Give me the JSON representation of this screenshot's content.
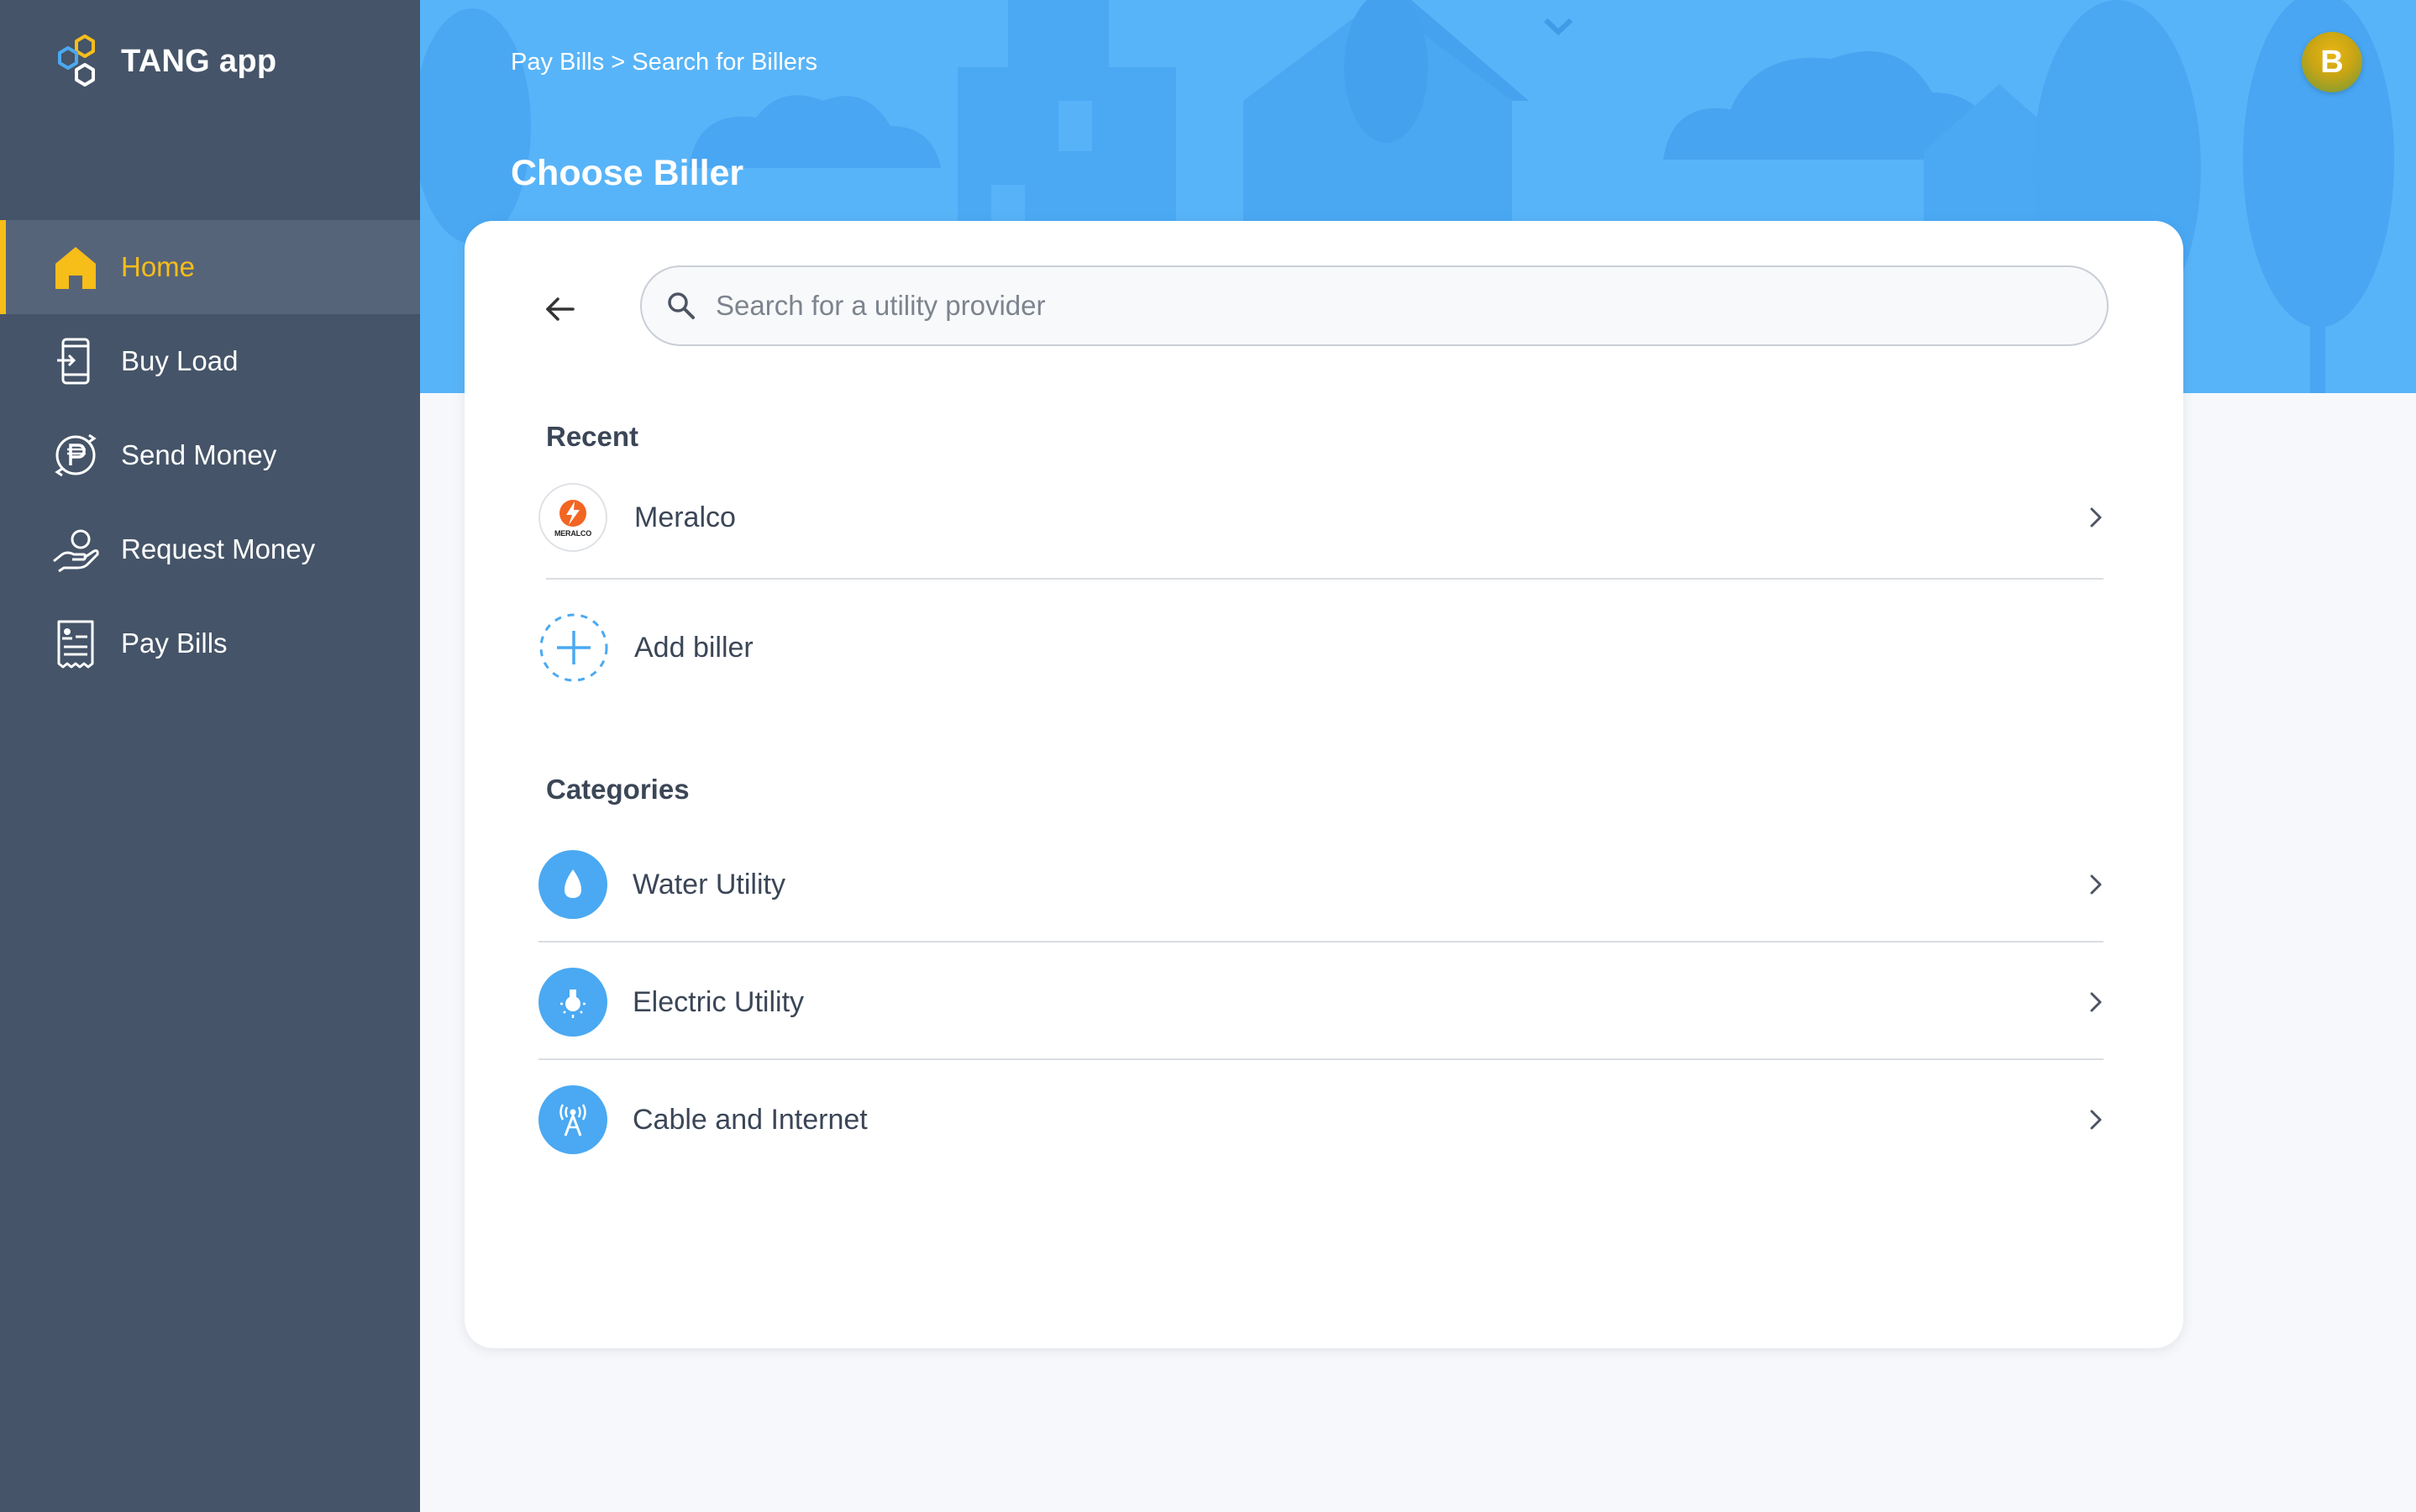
{
  "app": {
    "name": "TANG app"
  },
  "sidebar": {
    "items": [
      {
        "label": "Home",
        "icon": "home-icon",
        "active": true
      },
      {
        "label": "Buy Load",
        "icon": "phone-load-icon",
        "active": false
      },
      {
        "label": "Send Money",
        "icon": "send-money-icon",
        "active": false
      },
      {
        "label": "Request Money",
        "icon": "request-money-icon",
        "active": false
      },
      {
        "label": "Pay Bills",
        "icon": "bill-icon",
        "active": false
      }
    ]
  },
  "header": {
    "breadcrumb": "Pay Bills > Search for Billers",
    "title": "Choose Biller",
    "avatar_initial": "B"
  },
  "search": {
    "value": "",
    "placeholder": "Search for a utility provider"
  },
  "recent": {
    "title": "Recent",
    "items": [
      {
        "label": "Meralco",
        "logo_text": "MERALCO"
      }
    ],
    "add_label": "Add biller"
  },
  "categories": {
    "title": "Categories",
    "items": [
      {
        "label": "Water Utility",
        "icon": "water-drop-icon"
      },
      {
        "label": "Electric Utility",
        "icon": "light-bulb-icon"
      },
      {
        "label": "Cable and Internet",
        "icon": "antenna-icon"
      }
    ]
  },
  "colors": {
    "sidebar_bg": "#455468",
    "accent_yellow": "#f7bd19",
    "banner_blue": "#58b4f8",
    "icon_blue": "#4aa9f2",
    "text_dark": "#3b4657"
  }
}
